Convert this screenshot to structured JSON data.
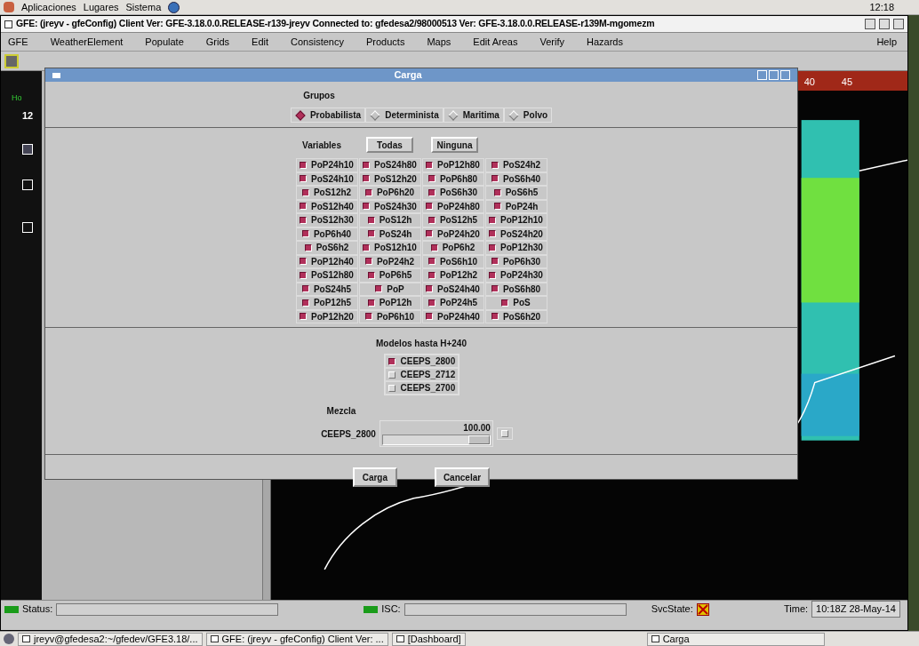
{
  "top_panel": {
    "menus": [
      "Aplicaciones",
      "Lugares",
      "Sistema"
    ],
    "clock": "12:18"
  },
  "window": {
    "title": "GFE: (jreyv - gfeConfig) Client Ver: GFE-3.18.0.0.RELEASE-r139-jreyv Connected to: gfedesa2/98000513 Ver: GFE-3.18.0.0.RELEASE-r139M-mgomezm",
    "menus": [
      "GFE",
      "WeatherElement",
      "Populate",
      "Grids",
      "Edit",
      "Consistency",
      "Products",
      "Maps",
      "Edit Areas",
      "Verify",
      "Hazards"
    ],
    "help": "Help"
  },
  "left_strip": {
    "label": "Ho",
    "hour": "12"
  },
  "timeline": {
    "labels": [
      "40",
      "45"
    ]
  },
  "dialog": {
    "title": "Carga",
    "groups": {
      "label": "Grupos",
      "options": [
        {
          "label": "Probabilista",
          "selected": true
        },
        {
          "label": "Determinista",
          "selected": false
        },
        {
          "label": "Maritima",
          "selected": false
        },
        {
          "label": "Polvo",
          "selected": false
        }
      ]
    },
    "variables": {
      "label": "Variables",
      "buttons": [
        "Todas",
        "Ninguna"
      ],
      "items": [
        {
          "label": "PoP24h10",
          "checked": true
        },
        {
          "label": "PoS24h80",
          "checked": true
        },
        {
          "label": "PoP12h80",
          "checked": true
        },
        {
          "label": "PoS24h2",
          "checked": true
        },
        {
          "label": "PoS24h10",
          "checked": true
        },
        {
          "label": "PoS12h20",
          "checked": true
        },
        {
          "label": "PoP6h80",
          "checked": true
        },
        {
          "label": "PoS6h40",
          "checked": true
        },
        {
          "label": "PoS12h2",
          "checked": true
        },
        {
          "label": "PoP6h20",
          "checked": true
        },
        {
          "label": "PoS6h30",
          "checked": true
        },
        {
          "label": "PoS6h5",
          "checked": true
        },
        {
          "label": "PoS12h40",
          "checked": true
        },
        {
          "label": "PoS24h30",
          "checked": true
        },
        {
          "label": "PoP24h80",
          "checked": true
        },
        {
          "label": "PoP24h",
          "checked": true
        },
        {
          "label": "PoS12h30",
          "checked": true
        },
        {
          "label": "PoS12h",
          "checked": true
        },
        {
          "label": "PoS12h5",
          "checked": true
        },
        {
          "label": "PoP12h10",
          "checked": true
        },
        {
          "label": "PoP6h40",
          "checked": true
        },
        {
          "label": "PoS24h",
          "checked": true
        },
        {
          "label": "PoP24h20",
          "checked": true
        },
        {
          "label": "PoS24h20",
          "checked": true
        },
        {
          "label": "PoS6h2",
          "checked": true
        },
        {
          "label": "PoS12h10",
          "checked": true
        },
        {
          "label": "PoP6h2",
          "checked": true
        },
        {
          "label": "PoP12h30",
          "checked": true
        },
        {
          "label": "PoP12h40",
          "checked": true
        },
        {
          "label": "PoP24h2",
          "checked": true
        },
        {
          "label": "PoS6h10",
          "checked": true
        },
        {
          "label": "PoP6h30",
          "checked": true
        },
        {
          "label": "PoS12h80",
          "checked": true
        },
        {
          "label": "PoP6h5",
          "checked": true
        },
        {
          "label": "PoP12h2",
          "checked": true
        },
        {
          "label": "PoP24h30",
          "checked": true
        },
        {
          "label": "PoS24h5",
          "checked": true
        },
        {
          "label": "PoP",
          "checked": true
        },
        {
          "label": "PoS24h40",
          "checked": true
        },
        {
          "label": "PoS6h80",
          "checked": true
        },
        {
          "label": "PoP12h5",
          "checked": true
        },
        {
          "label": "PoP12h",
          "checked": true
        },
        {
          "label": "PoP24h5",
          "checked": true
        },
        {
          "label": "PoS",
          "checked": true
        },
        {
          "label": "PoP12h20",
          "checked": true
        },
        {
          "label": "PoP6h10",
          "checked": true
        },
        {
          "label": "PoP24h40",
          "checked": true
        },
        {
          "label": "PoS6h20",
          "checked": true
        }
      ]
    },
    "models": {
      "label": "Modelos hasta H+240",
      "items": [
        {
          "label": "CEEPS_2800",
          "checked": true
        },
        {
          "label": "CEEPS_2712",
          "checked": false
        },
        {
          "label": "CEEPS_2700",
          "checked": false
        }
      ]
    },
    "mix": {
      "label": "Mezcla",
      "rows": [
        {
          "name": "CEEPS_2800",
          "value": "100.00",
          "level": 1,
          "checked": false
        }
      ]
    },
    "buttons": [
      "Carga",
      "Cancelar"
    ]
  },
  "status_bar": {
    "status": "Status:",
    "isc": "ISC:",
    "svc": "SvcState:",
    "time_label": "Time:",
    "time": "10:18Z 28-May-14"
  },
  "taskbar": [
    "jreyv@gfedesa2:~/gfedev/GFE3.18/...",
    "GFE: (jreyv - gfeConfig) Client Ver: ...",
    "[Dashboard]",
    "Carga"
  ]
}
